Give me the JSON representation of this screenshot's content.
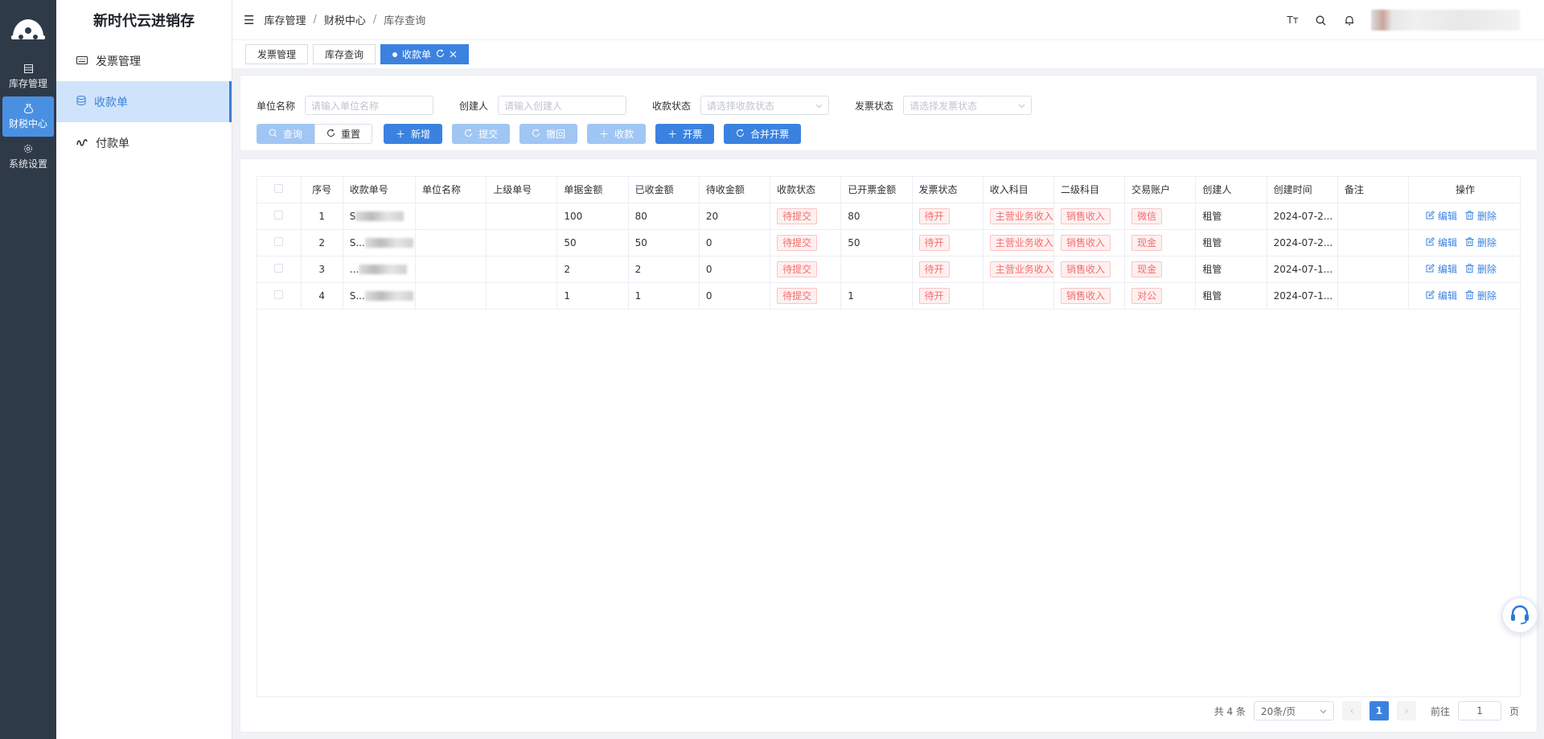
{
  "rail": {
    "items": [
      {
        "label": "库存管理",
        "icon": "grid-icon",
        "active": false
      },
      {
        "label": "财税中心",
        "icon": "money-bag-icon",
        "active": true
      },
      {
        "label": "系统设置",
        "icon": "gear-icon",
        "active": false
      }
    ]
  },
  "sidebar": {
    "title": "新时代云进销存",
    "items": [
      {
        "label": "发票管理",
        "icon": "keyboard-icon"
      },
      {
        "label": "收款单",
        "icon": "database-icon"
      },
      {
        "label": "付款单",
        "icon": "stock-icon"
      }
    ]
  },
  "header": {
    "breadcrumb": [
      "库存管理",
      "财税中心",
      "库存查询"
    ],
    "sep": "/",
    "font_icon": "Tт"
  },
  "tabs": [
    {
      "label": "发票管理"
    },
    {
      "label": "库存查询"
    },
    {
      "label": "收款单"
    }
  ],
  "filter": {
    "fields": [
      {
        "label": "单位名称",
        "placeholder": "请输入单位名称"
      },
      {
        "label": "创建人",
        "placeholder": "请输入创建人"
      },
      {
        "label": "收款状态",
        "placeholder": "请选择收款状态"
      },
      {
        "label": "发票状态",
        "placeholder": "请选择发票状态"
      }
    ],
    "buttons": {
      "search": "查询",
      "reset": "重置",
      "add": "新增",
      "submit": "提交",
      "revoke": "撤回",
      "collect": "收款",
      "invoice": "开票",
      "merge_invoice": "合并开票"
    }
  },
  "table": {
    "headers": [
      "序号",
      "收款单号",
      "单位名称",
      "上级单号",
      "单据金额",
      "已收金额",
      "待收金额",
      "收款状态",
      "已开票金额",
      "发票状态",
      "收入科目",
      "二级科目",
      "交易账户",
      "创建人",
      "创建时间",
      "备注",
      "操作"
    ],
    "rows": [
      {
        "no": "1",
        "code": "S",
        "unit": "",
        "parent": "",
        "amount": "100",
        "received": "80",
        "pending": "20",
        "status": "待提交",
        "invoiced": "80",
        "invoice_status": "待开",
        "income": "主营业务收入",
        "sub": "销售收入",
        "account": "微信",
        "creator": "租管",
        "created": "2024-07-2...",
        "remark": ""
      },
      {
        "no": "2",
        "code": "S...",
        "unit": "",
        "parent": "",
        "amount": "50",
        "received": "50",
        "pending": "0",
        "status": "待提交",
        "invoiced": "50",
        "invoice_status": "待开",
        "income": "主营业务收入",
        "sub": "销售收入",
        "account": "现金",
        "creator": "租管",
        "created": "2024-07-2...",
        "remark": ""
      },
      {
        "no": "3",
        "code": "...",
        "unit": "",
        "parent": "",
        "amount": "2",
        "received": "2",
        "pending": "0",
        "status": "待提交",
        "invoiced": "",
        "invoice_status": "待开",
        "income": "主营业务收入",
        "sub": "销售收入",
        "account": "现金",
        "creator": "租管",
        "created": "2024-07-1...",
        "remark": ""
      },
      {
        "no": "4",
        "code": "S...",
        "unit": "",
        "parent": "",
        "amount": "1",
        "received": "1",
        "pending": "0",
        "status": "待提交",
        "invoiced": "1",
        "invoice_status": "待开",
        "income": "",
        "sub": "销售收入",
        "account": "对公",
        "creator": "租管",
        "created": "2024-07-1...",
        "remark": ""
      }
    ],
    "ops": {
      "edit": "编辑",
      "delete": "删除"
    }
  },
  "pager": {
    "total": "共 4 条",
    "size": "20条/页",
    "current": "1",
    "goto": "前往",
    "goto_value": "1",
    "page_unit": "页"
  },
  "colors": {
    "accent": "#3b82e0",
    "rail": "#2f3a48",
    "tag_red": "#f56c6c"
  }
}
